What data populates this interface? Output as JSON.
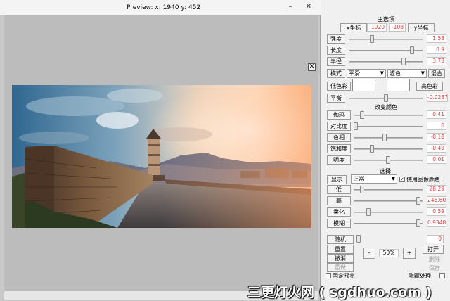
{
  "preview": {
    "title": "Preview:  x: 1940 y: 452",
    "minimize_icon": "minimize-icon",
    "close_icon": "close-icon",
    "fit_icon": "fit-window-icon"
  },
  "panel": {
    "main_option_title": "主选项",
    "x_coord_label": "x坐标",
    "x_value": "1920",
    "y_value": "-108",
    "y_coord_label": "y坐标",
    "params": [
      {
        "label": "强度",
        "value": "1.58",
        "level": 0.3
      },
      {
        "label": "长度",
        "value": "0.9",
        "level": 0.88
      },
      {
        "label": "半径",
        "value": "3.73",
        "level": 0.75
      }
    ],
    "mode_label": "模式",
    "mode_value": "平滑",
    "blend_value": "滤色",
    "mix_label": "混合",
    "low_color_label": "低色彩",
    "high_color_label": "高色彩",
    "balance_label": "平衡",
    "balance_value": "-0.0287",
    "change_color_title": "改变颜色",
    "color_params": [
      {
        "label": "伽玛",
        "value": "0.41",
        "level": 0.1
      },
      {
        "label": "对比度",
        "value": "0",
        "level": 0.0
      },
      {
        "label": "色相",
        "value": "-0.18",
        "level": 0.45
      },
      {
        "label": "饱和度",
        "value": "-0.49",
        "level": 0.25
      },
      {
        "label": "明度",
        "value": "0.01",
        "level": 0.5
      }
    ],
    "select_title": "选择",
    "display_label": "显示",
    "display_value": "正常",
    "use_image_color_label": "使用图像颜色",
    "use_image_color_checked": true,
    "select_params": [
      {
        "label": "低",
        "value": "28.29",
        "level": 0.1
      },
      {
        "label": "高",
        "value": "246.602",
        "level": 0.97
      },
      {
        "label": "柔化",
        "value": "0.59",
        "level": 0.2
      },
      {
        "label": "模糊",
        "value": "0.93486",
        "level": 0.97
      }
    ],
    "random_label": "随机",
    "random_value": "0",
    "reset_label": "重置",
    "undo_label": "撤消",
    "redo_label": "重做",
    "zoom_minus": "-",
    "zoom_value": "50%",
    "zoom_plus": "+",
    "open_label": "打开",
    "delete_label": "删除",
    "save_label": "保存",
    "fixed_preview_label": "固定预览",
    "hide_process_label": "隐藏处理"
  },
  "watermark": "三更灯火网 ( sgdhuo.com )"
}
